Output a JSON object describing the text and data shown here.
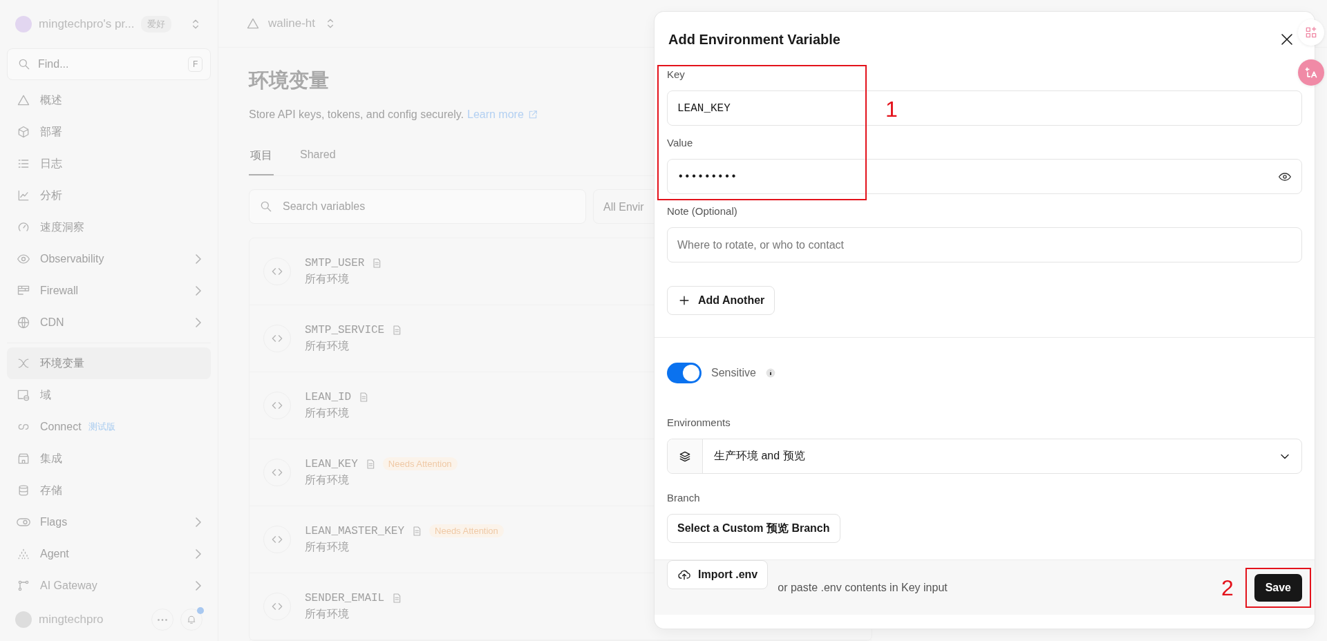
{
  "team": {
    "name": "mingtechpro's pr...",
    "badge": "爱好"
  },
  "search": {
    "placeholder": "Find...",
    "shortcut": "F"
  },
  "nav_groups": [
    [
      {
        "label": "概述",
        "selected": false,
        "submenu": false
      },
      {
        "label": "部署",
        "selected": false,
        "submenu": false
      },
      {
        "label": "日志",
        "selected": false,
        "submenu": false
      },
      {
        "label": "分析",
        "selected": false,
        "submenu": false
      },
      {
        "label": "速度洞察",
        "selected": false,
        "submenu": false
      },
      {
        "label": "Observability",
        "selected": false,
        "submenu": true
      },
      {
        "label": "Firewall",
        "selected": false,
        "submenu": true
      },
      {
        "label": "CDN",
        "selected": false,
        "submenu": true
      }
    ],
    [
      {
        "label": "环境变量",
        "selected": true,
        "submenu": false
      },
      {
        "label": "域",
        "selected": false,
        "submenu": false
      },
      {
        "label": "Connect",
        "tag": "测试版",
        "selected": false,
        "submenu": false
      },
      {
        "label": "集成",
        "selected": false,
        "submenu": false
      },
      {
        "label": "存储",
        "selected": false,
        "submenu": false
      },
      {
        "label": "Flags",
        "selected": false,
        "submenu": true
      },
      {
        "label": "Agent",
        "selected": false,
        "submenu": true
      },
      {
        "label": "AI Gateway",
        "selected": false,
        "submenu": true
      }
    ]
  ],
  "user": {
    "name": "mingtechpro",
    "notification": true
  },
  "project": {
    "name": "waline-ht"
  },
  "page": {
    "title": "环境变量",
    "description": "Store API keys, tokens, and config securely.",
    "link": "Learn more"
  },
  "tabs": [
    {
      "label": "项目",
      "selected": true
    },
    {
      "label": "Shared",
      "selected": false
    }
  ],
  "filter": {
    "placeholder": "Search variables",
    "environment": "All Envir"
  },
  "variables": [
    {
      "name": "SMTP_USER",
      "scope": "所有环境"
    },
    {
      "name": "SMTP_SERVICE",
      "scope": "所有环境"
    },
    {
      "name": "LEAN_ID",
      "scope": "所有环境"
    },
    {
      "name": "LEAN_KEY",
      "scope": "所有环境",
      "badge": "Needs Attention"
    },
    {
      "name": "LEAN_MASTER_KEY",
      "scope": "所有环境",
      "badge": "Needs Attention"
    },
    {
      "name": "SENDER_EMAIL",
      "scope": "所有环境"
    }
  ],
  "dialog": {
    "title": "Add Environment Variable",
    "fields": [
      {
        "label": "Key",
        "value": "LEAN_KEY",
        "kind": "text"
      },
      {
        "label": "Value",
        "value": "•••••••••",
        "kind": "secret"
      },
      {
        "label": "Note (Optional)",
        "placeholder": "Where to rotate, or who to contact",
        "kind": "text"
      }
    ],
    "add_button": "Add Another",
    "sensitive": {
      "label": "Sensitive",
      "on": true
    },
    "environments": {
      "label": "Environments",
      "value": "生产环境 and 预览"
    },
    "branch": {
      "label": "Branch",
      "button": "Select a Custom 预览 Branch"
    },
    "import_button": "Import .env",
    "import_hint": "or paste .env contents in Key input",
    "save_button": "Save"
  },
  "annotations": [
    {
      "label": "1",
      "kind": "fields"
    },
    {
      "label": "2",
      "kind": "save"
    }
  ]
}
